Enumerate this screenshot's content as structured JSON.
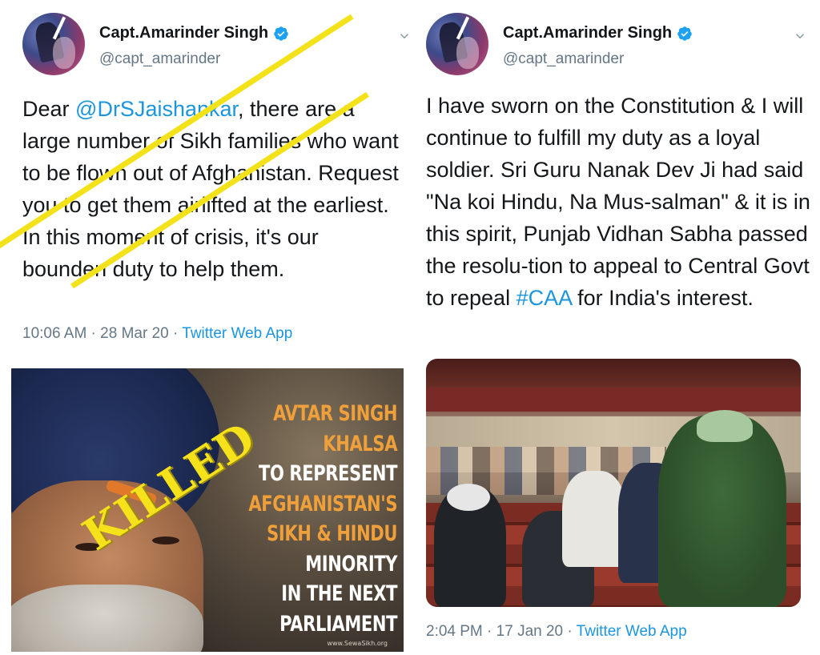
{
  "left_tweet": {
    "author": {
      "display_name": "Capt.Amarinder Singh",
      "handle": "@capt_amarinder"
    },
    "text": {
      "p1": "Dear ",
      "mention": "@DrSJaishankar",
      "p2": ", there are a large number of Sikh families who want to be flown out of Afghanistan. Request you to get them airlifted at the earliest. In this moment of crisis, it's our bounden duty to help them."
    },
    "meta": {
      "time": "10:06 AM",
      "date": "28 Mar 20",
      "separator": " · ",
      "source": "Twitter Web App"
    },
    "image": {
      "poster_lines": [
        {
          "text": "AVTAR SINGH",
          "color": "orange"
        },
        {
          "text": "KHALSA",
          "color": "orange"
        },
        {
          "text": "TO REPRESENT",
          "color": "white"
        },
        {
          "text": "AFGHANISTAN'S",
          "color": "orange"
        },
        {
          "text": "SIKH & HINDU",
          "color": "orange"
        },
        {
          "text": "MINORITY",
          "color": "white"
        },
        {
          "text": "IN THE NEXT",
          "color": "white"
        },
        {
          "text": "PARLIAMENT",
          "color": "white"
        }
      ],
      "stamp": "KILLED",
      "watermark": "www.SewaSikh.org"
    }
  },
  "right_tweet": {
    "author": {
      "display_name": "Capt.Amarinder Singh",
      "handle": "@capt_amarinder"
    },
    "text": {
      "p1": "I have sworn on the Constitution & I will continue to fulfill my duty as a loyal soldier. Sri Guru Nanak Dev Ji had said \"Na koi Hindu, Na Mus-salman\" & it is in this spirit, Punjab Vidhan Sabha passed the resolu-tion to appeal to Central Govt to repeal ",
      "hashtag": "#CAA",
      "p2": " for India's interest."
    },
    "meta": {
      "time": "2:04 PM",
      "date": "17 Jan 20",
      "separator": " · ",
      "source": "Twitter Web App"
    }
  },
  "icons": {
    "verified": "verified-badge-icon",
    "chevron": "chevron-down-icon"
  },
  "colors": {
    "link": "#1b95e0",
    "muted": "#657786",
    "text": "#14171a",
    "poster_orange": "#f0a03a",
    "stamp_yellow": "#f3e21a"
  }
}
